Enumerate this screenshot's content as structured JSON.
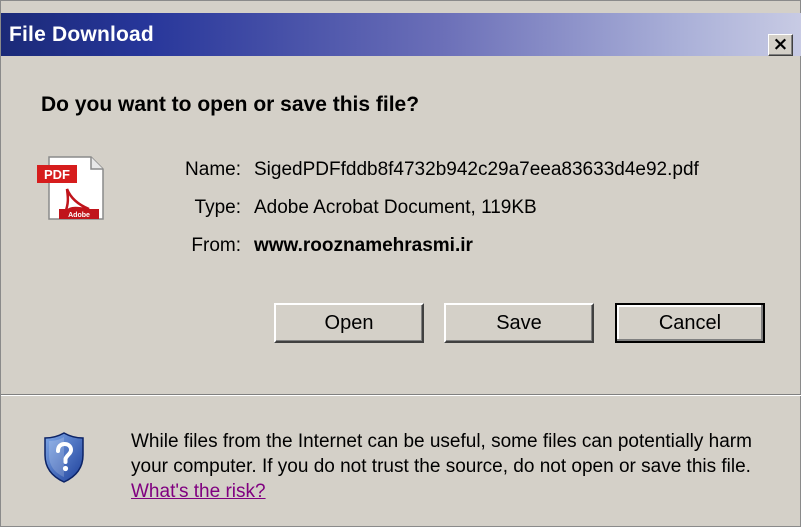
{
  "window": {
    "title": "File Download",
    "close_symbol": "×"
  },
  "dialog": {
    "question": "Do you want to open or save this file?",
    "file_icon": "pdf-file-icon",
    "file_icon_text": "PDF",
    "file_icon_brand": "Adobe",
    "fields": {
      "name_label": "Name:",
      "name_value": "SigedPDFfddb8f4732b942c29a7eea83633d4e92.pdf",
      "type_label": "Type:",
      "type_value": "Adobe Acrobat Document, 119KB",
      "from_label": "From:",
      "from_value": "www.rooznamehrasmi.ir"
    },
    "buttons": {
      "open": "Open",
      "save": "Save",
      "cancel": "Cancel"
    }
  },
  "warning": {
    "icon": "shield-question-icon",
    "text": "While files from the Internet can be useful, some files can potentially harm your computer. If you do not trust the source, do not open or save this file.",
    "link_text": "What's the risk?"
  },
  "colors": {
    "titlebar_start": "#1b2a78",
    "titlebar_end": "#c8cbe4",
    "dialog_bg": "#d4d0c8",
    "link": "#800080"
  }
}
